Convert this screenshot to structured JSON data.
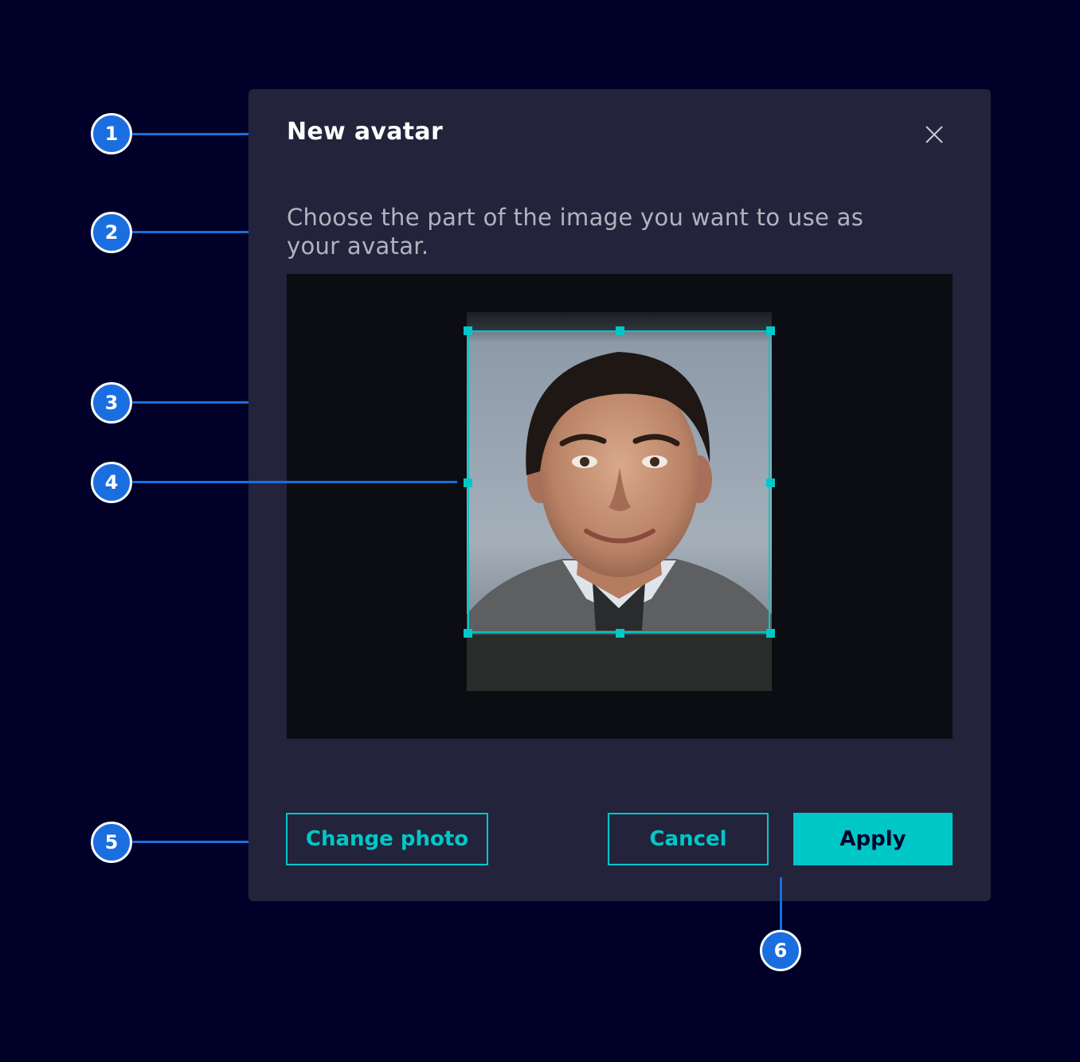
{
  "dialog": {
    "title": "New avatar",
    "description": "Choose the part of the image you want to use as your avatar.",
    "close_icon": "close-icon",
    "buttons": {
      "change_photo": "Change photo",
      "cancel": "Cancel",
      "apply": "Apply"
    }
  },
  "callouts": [
    "1",
    "2",
    "3",
    "4",
    "5",
    "6"
  ],
  "colors": {
    "background": "#000028",
    "dialog": "#23233c",
    "accent": "#00c8c8",
    "callout": "#1a6ee0"
  }
}
